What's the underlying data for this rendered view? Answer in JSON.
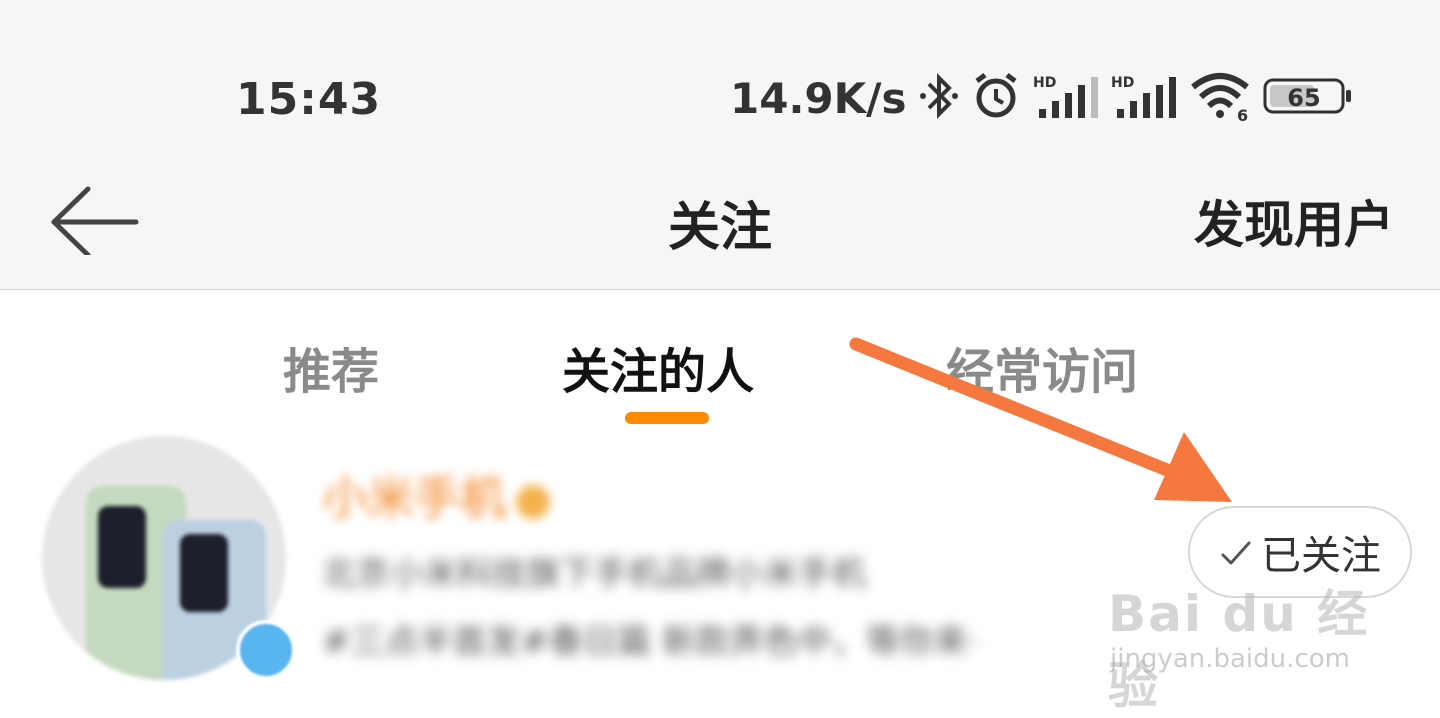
{
  "status_bar": {
    "time": "15:43",
    "net_speed": "14.9K/s",
    "battery": "65",
    "signal_label": "HD",
    "wifi_label": "6",
    "icons": [
      "bluetooth-icon",
      "alarm-icon",
      "signal-icon",
      "signal-icon",
      "wifi-icon",
      "battery-icon"
    ]
  },
  "nav": {
    "back_icon": "arrow-left-icon",
    "title": "关注",
    "discover": "发现用户"
  },
  "tabs": [
    {
      "label": "推荐",
      "active": false
    },
    {
      "label": "关注的人",
      "active": true
    },
    {
      "label": "经常访问",
      "active": false
    }
  ],
  "user": {
    "name": "小米手机",
    "desc1": "北京小米科技旗下手机品牌小米手机",
    "desc2": "#三点半首发#春日篇 新款弄色中，等你来·",
    "follow_label": "已关注",
    "follow_icon": "check-icon"
  },
  "watermark": {
    "brand": "Bai du 经验",
    "url": "jingyan.baidu.com"
  },
  "colors": {
    "accent": "#ff8a00",
    "arrow": "#f5793f",
    "bar_bg": "#f6f6f6",
    "verify": "#58b5f0"
  }
}
